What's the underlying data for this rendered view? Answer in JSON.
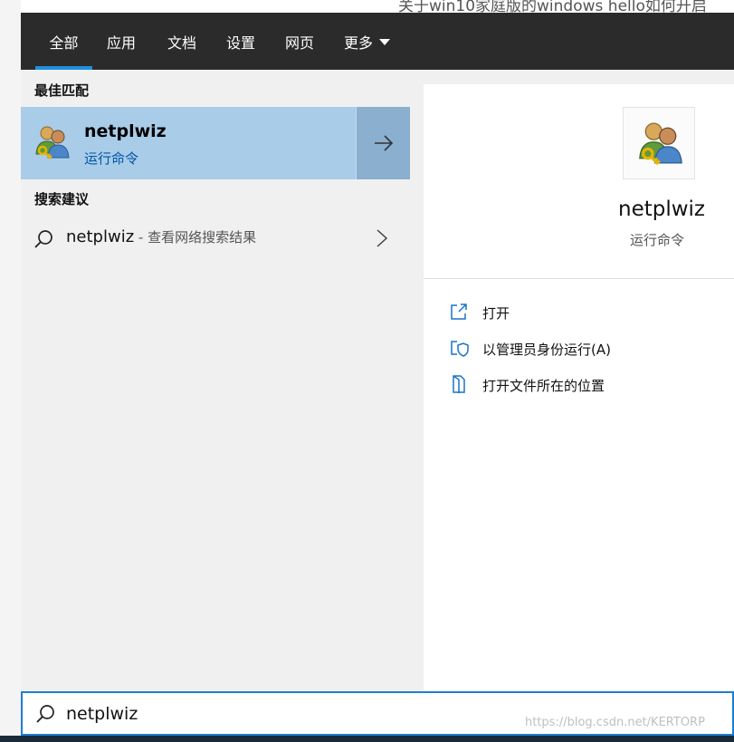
{
  "background": {
    "title_fragment": "关于win10家庭版的windows hello如何开启"
  },
  "tabs": [
    {
      "label": "全部",
      "active": true
    },
    {
      "label": "应用",
      "active": false
    },
    {
      "label": "文档",
      "active": false
    },
    {
      "label": "设置",
      "active": false
    },
    {
      "label": "网页",
      "active": false
    },
    {
      "label": "更多",
      "active": false
    }
  ],
  "results": {
    "best_match_header": "最佳匹配",
    "best_match": {
      "name": "netplwiz",
      "subtitle": "运行命令",
      "icon": "user-accounts-key-icon"
    },
    "suggestions_header": "搜索建议",
    "suggestion": {
      "query": "netplwiz",
      "separator": " - ",
      "description": "查看网络搜索结果"
    }
  },
  "detail": {
    "name": "netplwiz",
    "subtitle": "运行命令",
    "icon": "user-accounts-key-icon",
    "actions": [
      {
        "label": "打开",
        "icon": "open-icon"
      },
      {
        "label": "以管理员身份运行(A)",
        "icon": "run-as-admin-icon"
      },
      {
        "label": "打开文件所在的位置",
        "icon": "file-location-icon"
      }
    ]
  },
  "search": {
    "value": "netplwiz",
    "watermark": "https://blog.csdn.net/KERTORP"
  },
  "colors": {
    "tabbar_bg": "#2b2b2b",
    "accent": "#1f8fe0",
    "best_match_bg": "#a9cce8",
    "best_match_arrow_bg": "#8aafcf",
    "link_blue": "#0054a6"
  }
}
